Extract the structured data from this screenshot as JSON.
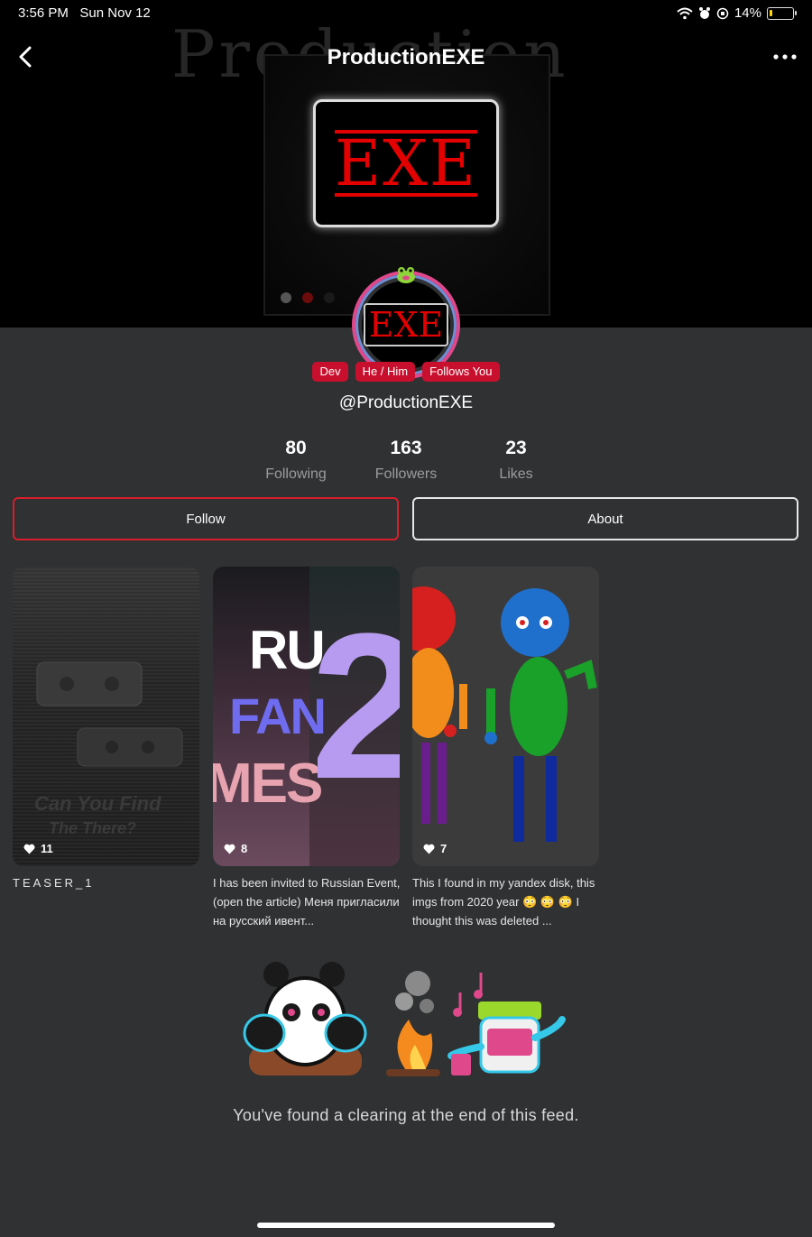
{
  "status_bar": {
    "time": "3:56 PM",
    "date": "Sun Nov 12",
    "battery": "14%",
    "battery_level": 0.14
  },
  "header": {
    "title": "ProductionEXE",
    "back_icon": "chevron-left-icon",
    "more_icon": "more-dots-icon"
  },
  "banner": {
    "watermark": "Production",
    "screen_text": "EXE"
  },
  "profile": {
    "avatar_text": "EXE",
    "badges": [
      "Dev",
      "He / Him",
      "Follows You"
    ],
    "handle": "@ProductionEXE",
    "badge_color": "#c8102e"
  },
  "stats": [
    {
      "value": "80",
      "label": "Following"
    },
    {
      "value": "163",
      "label": "Followers"
    },
    {
      "value": "23",
      "label": "Likes"
    }
  ],
  "actions": {
    "follow": "Follow",
    "about": "About",
    "follow_border": "#d71e2a"
  },
  "posts": [
    {
      "likes": "11",
      "caption": "TEASER_1",
      "overlay_text": "Can You Find",
      "overlay_text2": "The There?"
    },
    {
      "likes": "8",
      "caption": "I has been invited to Russian Event,(open the article) Меня пригласили на русский ивент...",
      "thumb_text": [
        "RU",
        "FAN",
        "MES",
        "2"
      ]
    },
    {
      "likes": "7",
      "caption": "This I found in my yandex disk, this imgs from 2020 year 😳 😳 😳 I thought this was deleted ..."
    }
  ],
  "feed_end": {
    "message": "You've found a clearing at the end of this feed."
  }
}
